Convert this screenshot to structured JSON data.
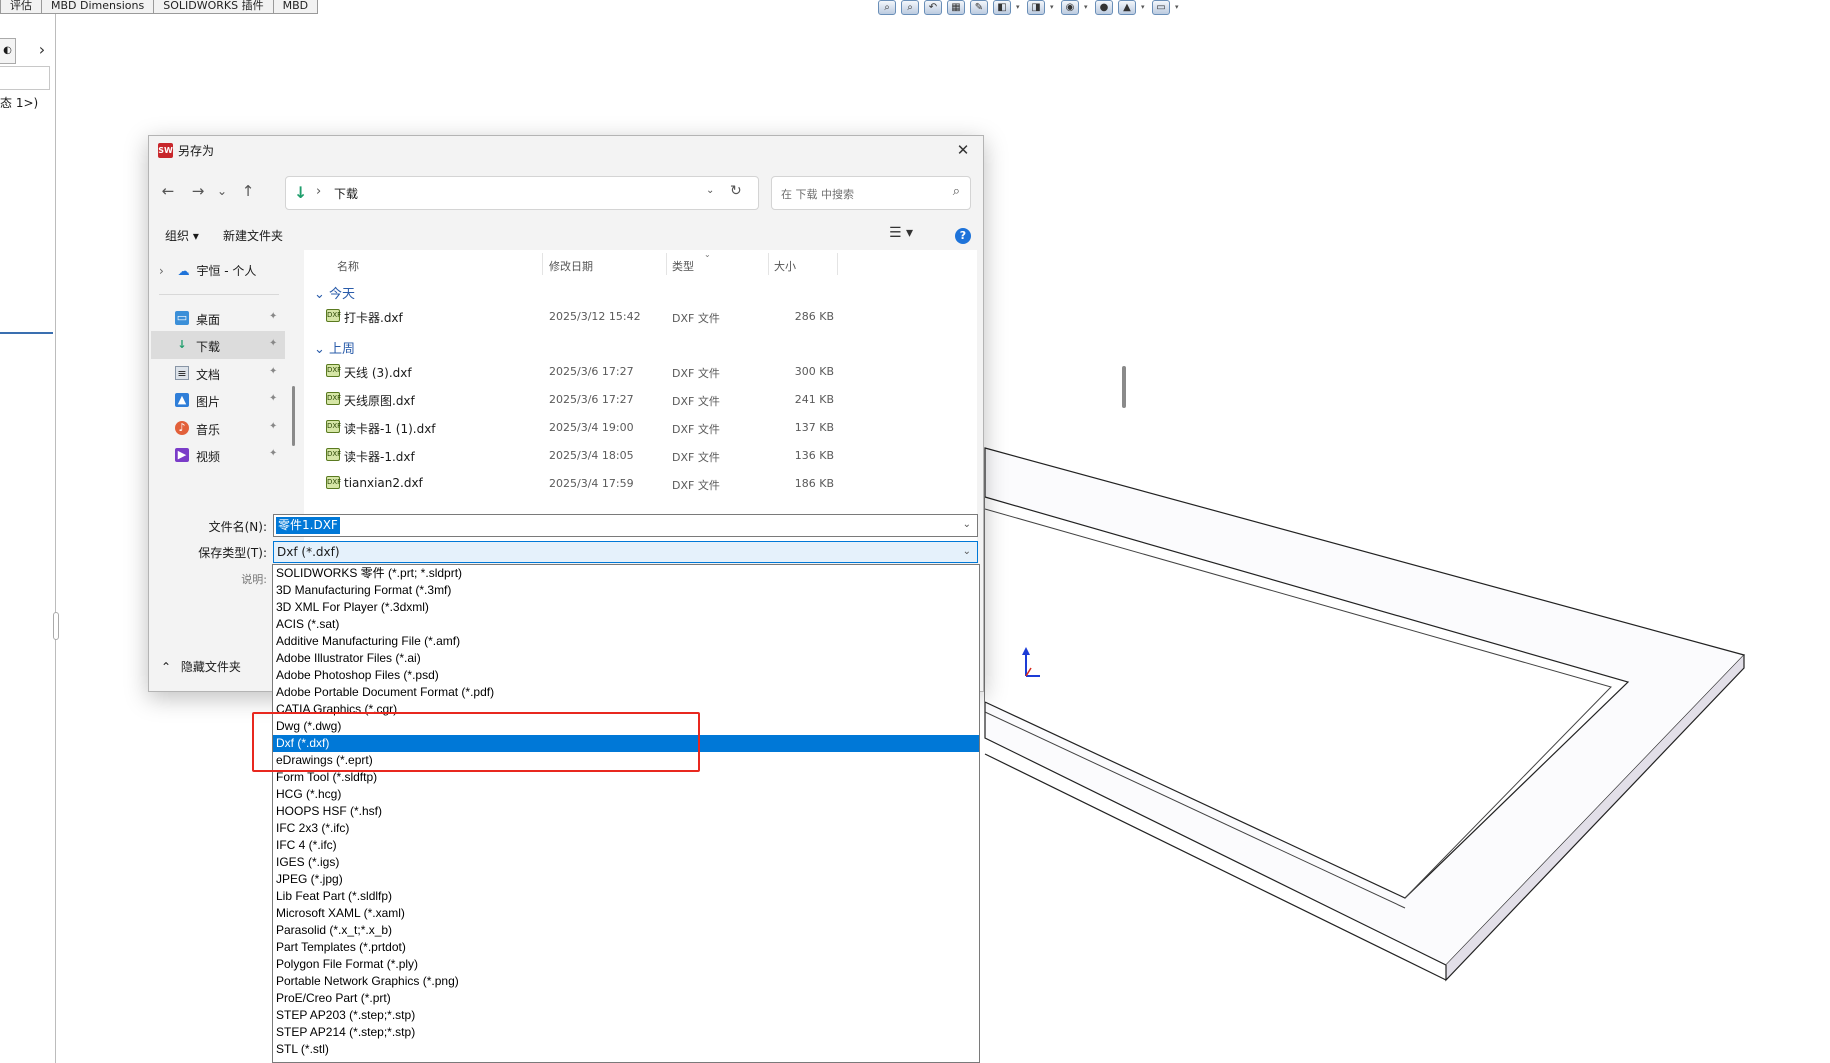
{
  "app": {
    "cmd_tabs": [
      "评估",
      "MBD Dimensions",
      "SOLIDWORKS 插件",
      "MBD"
    ],
    "left_panel_state": "态 1>)",
    "left_panel_arrow": "›"
  },
  "dialog": {
    "title": "另存为",
    "nav": {
      "back": "←",
      "forward": "→",
      "recent": "⌄",
      "up": "↑"
    },
    "address": {
      "path_sep": "›",
      "path": "下载",
      "refresh": "↻"
    },
    "search": {
      "placeholder": "在 下载 中搜索"
    },
    "commandbar": {
      "organize": "组织 ▾",
      "new_folder": "新建文件夹",
      "view": "☰ ▾",
      "help": "?"
    },
    "nav_pane": {
      "cloud": "宇恒 - 个人",
      "quick_access": [
        {
          "label": "桌面",
          "icon": "desktop-icon"
        },
        {
          "label": "下载",
          "icon": "download-icon"
        },
        {
          "label": "文档",
          "icon": "document-icon"
        },
        {
          "label": "图片",
          "icon": "pictures-icon"
        },
        {
          "label": "音乐",
          "icon": "music-icon"
        },
        {
          "label": "视频",
          "icon": "video-icon"
        }
      ]
    },
    "columns": {
      "name": "名称",
      "modified": "修改日期",
      "type": "类型",
      "size": "大小"
    },
    "groups": [
      {
        "label": "今天",
        "files": [
          {
            "name": "打卡器.dxf",
            "date": "2025/3/12 15:42",
            "type": "DXF 文件",
            "size": "286 KB"
          }
        ]
      },
      {
        "label": "上周",
        "files": [
          {
            "name": "天线 (3).dxf",
            "date": "2025/3/6 17:27",
            "type": "DXF 文件",
            "size": "300 KB"
          },
          {
            "name": "天线原图.dxf",
            "date": "2025/3/6 17:27",
            "type": "DXF 文件",
            "size": "241 KB"
          },
          {
            "name": "读卡器-1 (1).dxf",
            "date": "2025/3/4 19:00",
            "type": "DXF 文件",
            "size": "137 KB"
          },
          {
            "name": "读卡器-1.dxf",
            "date": "2025/3/4 18:05",
            "type": "DXF 文件",
            "size": "136 KB"
          },
          {
            "name": "tianxian2.dxf",
            "date": "2025/3/4 17:59",
            "type": "DXF 文件",
            "size": "186 KB"
          }
        ]
      }
    ],
    "filename_label": "文件名(N):",
    "filename_value": "零件1.DXF",
    "savetype_label": "保存类型(T):",
    "savetype_value": "Dxf (*.dxf)",
    "description_label": "说明:",
    "hide_folders": "隐藏文件夹"
  },
  "file_types": [
    "SOLIDWORKS 零件 (*.prt; *.sldprt)",
    "3D Manufacturing Format (*.3mf)",
    "3D XML For Player (*.3dxml)",
    "ACIS (*.sat)",
    "Additive Manufacturing File (*.amf)",
    "Adobe Illustrator Files (*.ai)",
    "Adobe Photoshop Files (*.psd)",
    "Adobe Portable Document Format (*.pdf)",
    "CATIA Graphics (*.cgr)",
    "Dwg (*.dwg)",
    "Dxf (*.dxf)",
    "eDrawings (*.eprt)",
    "Form Tool (*.sldftp)",
    "HCG (*.hcg)",
    "HOOPS HSF (*.hsf)",
    "IFC 2x3 (*.ifc)",
    "IFC 4 (*.ifc)",
    "IGES (*.igs)",
    "JPEG (*.jpg)",
    "Lib Feat Part (*.sldlfp)",
    "Microsoft XAML (*.xaml)",
    "Parasolid (*.x_t;*.x_b)",
    "Part Templates (*.prtdot)",
    "Polygon File Format (*.ply)",
    "Portable Network Graphics (*.png)",
    "ProE/Creo Part (*.prt)",
    "STEP AP203 (*.step;*.stp)",
    "STEP AP214 (*.step;*.stp)",
    "STL (*.stl)"
  ],
  "active_file_type_index": 10,
  "colors": {
    "accent": "#0078d7",
    "annotation": "#e8281f",
    "group_header": "#2a5caa"
  }
}
